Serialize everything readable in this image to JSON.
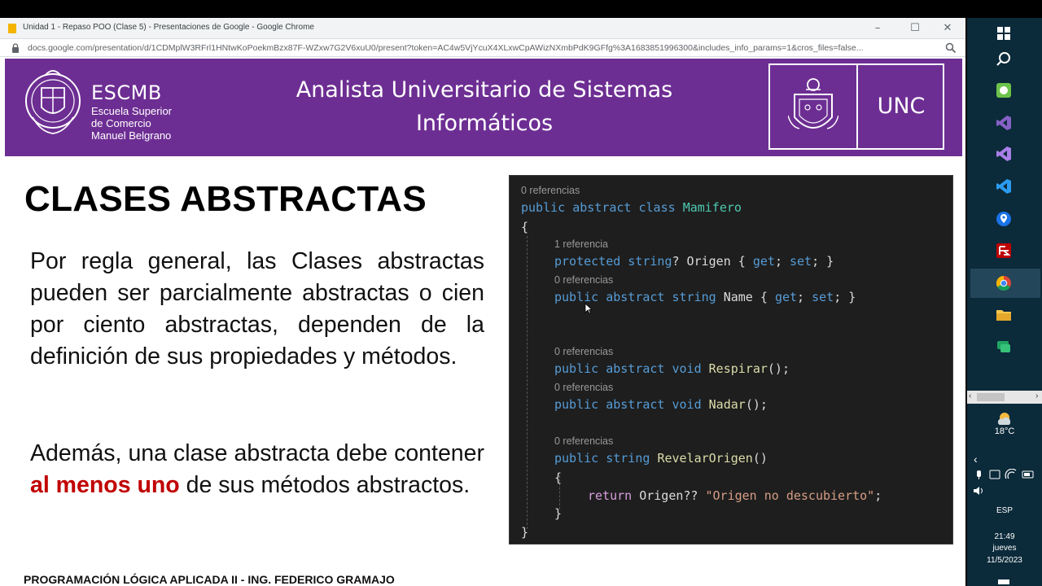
{
  "browser": {
    "window_title": "Unidad 1 - Repaso POO (Clase 5) - Presentaciones de Google - Google Chrome",
    "url": "docs.google.com/presentation/d/1CDMplW3RFrl1HNtwKoPoekmBzx87F-WZxw7G2V6xuU0/present?token=AC4w5VjYcuX4XLxwCpAWizNXmbPdK9GFfg%3A1683851996300&includes_info_params=1&cros_files=false...",
    "minimize": "–",
    "maximize": "☐",
    "close": "✕"
  },
  "header": {
    "school_name": "ESCMB",
    "school_line1": "Escuela Superior",
    "school_line2": "de Comercio",
    "school_line3": "Manuel Belgrano",
    "title_line1": "Analista Universitario de Sistemas",
    "title_line2": "Informáticos",
    "university": "UNC"
  },
  "slide": {
    "title": "CLASES ABSTRACTAS",
    "paragraph1": "Por regla general, las Clases abstractas pueden ser parcialmente abstractas o cien por ciento abstractas, dependen de la definición de sus propiedades y métodos.",
    "paragraph2_before": "Además, una clase abstracta debe contener ",
    "paragraph2_highlight": "al menos uno",
    "paragraph2_after": " de sus métodos abstractos.",
    "footer": "PROGRAMACIÓN LÓGICA APLICADA II - ING. FEDERICO GRAMAJO"
  },
  "code": {
    "ref0": "0 referencias",
    "ref1": "1 referencia",
    "ref2": "0 referencias",
    "ref3": "0 referencias",
    "ref4": "0 referencias",
    "ref5": "0 referencias",
    "line_class_kw": "public abstract class ",
    "line_class_name": "Mamifero",
    "open_brace": "{",
    "close_brace": "}",
    "origen_kw": "protected string",
    "origen_rest": "? Origen { ",
    "get": "get",
    "set": "set",
    "semi_sp": "; ",
    "end_brace": "}",
    "name_kw": "public abstract string",
    "name_rest": " Name { ",
    "respirar_kw": "public abstract void ",
    "respirar_name": "Respirar",
    "call_end": "();",
    "nadar_kw": "public abstract void ",
    "nadar_name": "Nadar",
    "revelar_kw": "public string ",
    "revelar_name": "RevelarOrigen",
    "parens": "()",
    "inner_open": "{",
    "inner_close": "}",
    "return_kw": "return",
    "return_mid": " Origen?? ",
    "return_str": "\"Origen no descubierto\"",
    "return_end": ";"
  },
  "taskbar": {
    "temperature": "18°C",
    "language": "ESP",
    "time": "21:49",
    "weekday": "jueves",
    "date": "11/5/2023"
  }
}
